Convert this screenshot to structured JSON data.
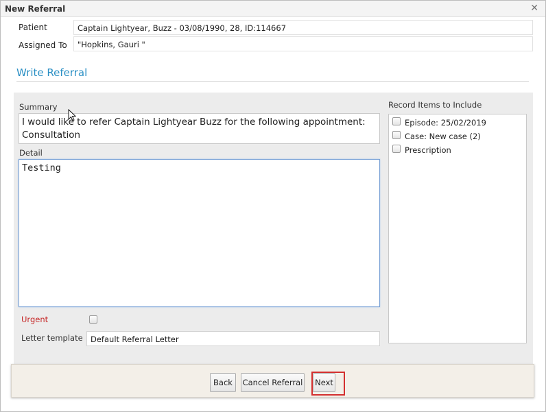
{
  "window": {
    "title": "New Referral",
    "close_glyph": "✕"
  },
  "patient": {
    "label": "Patient",
    "value": "Captain Lightyear, Buzz - 03/08/1990, 28, ID:114667"
  },
  "assigned_to": {
    "label": "Assigned To",
    "value": "\"Hopkins, Gauri \""
  },
  "section": {
    "title": "Write Referral"
  },
  "summary": {
    "label": "Summary",
    "value": "I would like to refer Captain Lightyear Buzz for the following appointment: Consultation"
  },
  "detail": {
    "label": "Detail",
    "value": "Testing"
  },
  "urgent": {
    "label": "Urgent",
    "checked": false
  },
  "letter_template": {
    "label": "Letter template",
    "value": "Default Referral Letter"
  },
  "record_items": {
    "label": "Record Items to Include",
    "items": [
      {
        "label": "Episode: 25/02/2019",
        "checked": false
      },
      {
        "label": "Case: New case (2)",
        "checked": false
      },
      {
        "label": "Prescription",
        "checked": false
      }
    ]
  },
  "buttons": {
    "back": "Back",
    "cancel": "Cancel Referral",
    "next": "Next"
  },
  "colors": {
    "section_title": "#2a8fc4",
    "urgent": "#c62828",
    "highlight": "#d32f2f"
  },
  "icons": {
    "close": "close-icon",
    "cursor": "mouse-pointer-icon"
  }
}
